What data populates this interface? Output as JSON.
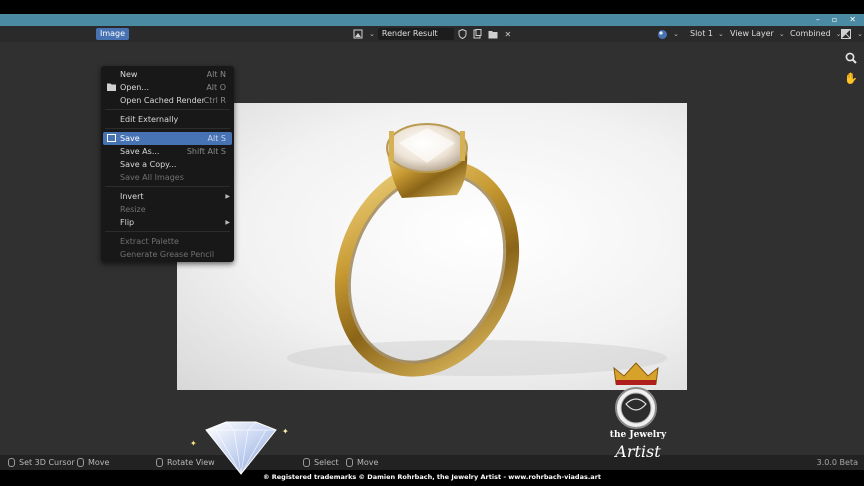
{
  "window": {
    "controls": [
      "–",
      "▫",
      "✕"
    ]
  },
  "header": {
    "image_menu_label": "Image",
    "render_name": "Render Result",
    "slot_label": "Slot 1",
    "view_layer_label": "View Layer",
    "pass_label": "Combined"
  },
  "image_menu": {
    "items": [
      {
        "label": "New",
        "shortcut": "Alt N"
      },
      {
        "label": "Open...",
        "shortcut": "Alt O"
      },
      {
        "label": "Open Cached Render",
        "shortcut": "Ctrl R"
      },
      {
        "label": "Edit Externally",
        "shortcut": ""
      },
      {
        "label": "Save",
        "shortcut": "Alt S"
      },
      {
        "label": "Save As...",
        "shortcut": "Shift Alt S"
      },
      {
        "label": "Save a Copy...",
        "shortcut": ""
      },
      {
        "label": "Save All Images",
        "shortcut": ""
      },
      {
        "label": "Invert",
        "shortcut": ""
      },
      {
        "label": "Resize",
        "shortcut": ""
      },
      {
        "label": "Flip",
        "shortcut": ""
      },
      {
        "label": "Extract Palette",
        "shortcut": ""
      },
      {
        "label": "Generate Grease Pencil",
        "shortcut": ""
      }
    ]
  },
  "statusbar": {
    "set_cursor": "Set 3D Cursor",
    "move1": "Move",
    "rotate_view": "Rotate View",
    "select": "Select",
    "move2": "Move",
    "version": "3.0.0 Beta"
  },
  "overlay": {
    "trademark": "® Registered trademarks © Damien Rohrbach, the Jewelry Artist - www.rohrbach-viadas.art",
    "logo_line1": "the Jewelry",
    "logo_line2": "Artist"
  },
  "colors": {
    "accent": "#4772b3",
    "titlebar": "#4a8aa3",
    "editor_bg": "#303030"
  },
  "icons": [
    "zoom-icon",
    "hand-icon",
    "folder-icon",
    "image-editor-icon",
    "shield-icon",
    "new-image-icon",
    "open-folder-icon",
    "close-icon",
    "material-icon",
    "display-mode-icon"
  ]
}
